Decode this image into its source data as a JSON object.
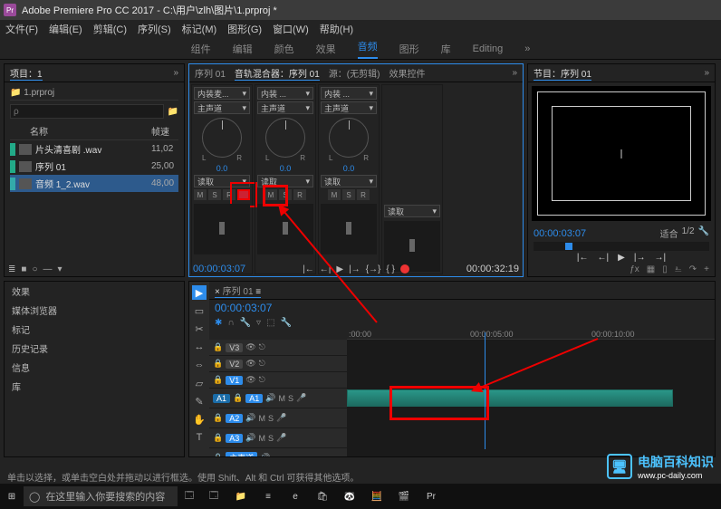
{
  "titlebar": {
    "app_icon": "Pr",
    "title": "Adobe Premiere Pro CC 2017 - C:\\用户\\zlh\\图片\\1.prproj *"
  },
  "menubar": [
    "文件(F)",
    "编辑(E)",
    "剪辑(C)",
    "序列(S)",
    "标记(M)",
    "图形(G)",
    "窗口(W)",
    "帮助(H)"
  ],
  "workspaces": {
    "items": [
      "组件",
      "编辑",
      "颜色",
      "效果",
      "音频",
      "图形",
      "库",
      "Editing"
    ],
    "active_index": 4
  },
  "project": {
    "tab": "项目：1",
    "breadcrumb": "1.prproj",
    "search_placeholder": "ρ",
    "newbin_title": "新建素材箱",
    "headers": {
      "name": "名称",
      "framerate": "帧速"
    },
    "rows": [
      {
        "swatch": "sw-green",
        "label": "片头清喜剧 .wav",
        "fr": "11,02"
      },
      {
        "swatch": "sw-green",
        "label": "序列 01",
        "fr": "25,00"
      },
      {
        "swatch": "sw-blue",
        "label": "音频 1_2.wav",
        "fr": "48,00"
      }
    ],
    "footer_icons": [
      "≣",
      "■",
      "○",
      "—",
      "▾"
    ]
  },
  "mixer": {
    "tabs": [
      "序列 01",
      "音轨混合器：序列 01",
      "源：(无剪辑)",
      "效果控件"
    ],
    "channels": [
      {
        "input": "内装麦...",
        "output": "主声道",
        "pan": "0.0",
        "mode": "读取",
        "msr": [
          "M",
          "S",
          "R"
        ],
        "record": true,
        "L": "L",
        "R": "R"
      },
      {
        "input": "内装 ...",
        "output": "主声道",
        "pan": "0.0",
        "mode": "读取",
        "msr": [
          "M",
          "S",
          "R"
        ],
        "record": false,
        "L": "L",
        "R": "R"
      },
      {
        "input": "内装 ...",
        "output": "主声道",
        "pan": "0.0",
        "mode": "读取",
        "msr": [
          "M",
          "S",
          "R"
        ],
        "record": false,
        "L": "L",
        "R": "R"
      }
    ],
    "master_mode": "读取",
    "timecode_left": "00:00:03:07",
    "timecode_right": "00:00:32:19",
    "transport_icons": [
      "|←",
      "←|",
      "▶",
      "|→",
      "{→}",
      "{ }"
    ]
  },
  "program": {
    "tab": "节目：序列 01",
    "timecode": "00:00:03:07",
    "fit": "适合",
    "ratio": "1/2",
    "play_icons": [
      "|←",
      "←|",
      "▶",
      "|→",
      "→|"
    ],
    "tool_icons": [
      "ƒx",
      "▦",
      "▯",
      "⎁",
      "↷",
      "+"
    ]
  },
  "effects": {
    "items": [
      "效果",
      "媒体浏览器",
      "标记",
      "历史记录",
      "信息",
      "库"
    ]
  },
  "timeline": {
    "tab": "序列 01",
    "timecode": "00:00:03:07",
    "icon_row": [
      "✱",
      "∩",
      "🔧",
      "▿",
      "⬚",
      "🔧"
    ],
    "ruler": [
      ":00:00",
      "00:00:05:00",
      "00:00:10:00"
    ],
    "video_tracks": [
      {
        "name": "V3",
        "locked": false,
        "eye": true
      },
      {
        "name": "V2",
        "locked": false,
        "eye": true
      },
      {
        "name": "V1",
        "locked": false,
        "eye": true,
        "v1": true
      }
    ],
    "audio_tracks": [
      {
        "src": "A1",
        "name": "A1",
        "m": "M",
        "s": "S",
        "mic": "🎤",
        "clip": {
          "start": 0,
          "end": 360
        }
      },
      {
        "src": "",
        "name": "A2",
        "m": "M",
        "s": "S",
        "mic": "🎤"
      },
      {
        "src": "",
        "name": "A3",
        "m": "M",
        "s": "S",
        "mic": "🎤"
      },
      {
        "src": "",
        "name": "主声道",
        "m": "",
        "s": "",
        "mic": ""
      }
    ],
    "tools": [
      "▶",
      "▭",
      "✂",
      "↔",
      "⇔",
      "▱",
      "✎",
      "✋",
      "T"
    ]
  },
  "statusbar": {
    "text": "单击以选择，或单击空白处并拖动以进行框选。使用 Shift、Alt 和 Ctrl 可获得其他选项。"
  },
  "taskbar": {
    "search_placeholder": "在这里输入你要搜索的内容",
    "apps": [
      "⊞",
      "◯",
      "🗔",
      "📁",
      "≡",
      "e",
      "🛍",
      "🐼",
      "🧮",
      "🎬",
      "Pr"
    ]
  },
  "watermark": {
    "main": "电脑百科知识",
    "sub": "www.pc-daily.com"
  }
}
